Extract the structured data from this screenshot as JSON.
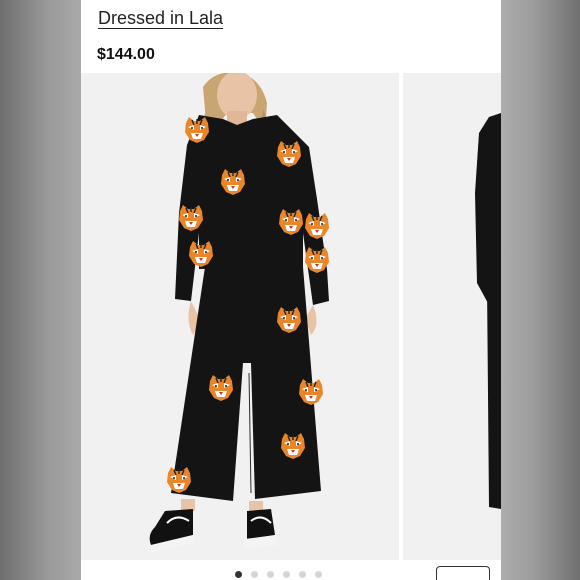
{
  "product": {
    "brand_label": "Dressed in Lala",
    "price": "$144.00"
  },
  "gallery": {
    "dot_count": 6,
    "active_index": 0
  },
  "colors": {
    "garment": "#141414",
    "background": "#f1f1f1",
    "tiger": "#e9862a"
  }
}
